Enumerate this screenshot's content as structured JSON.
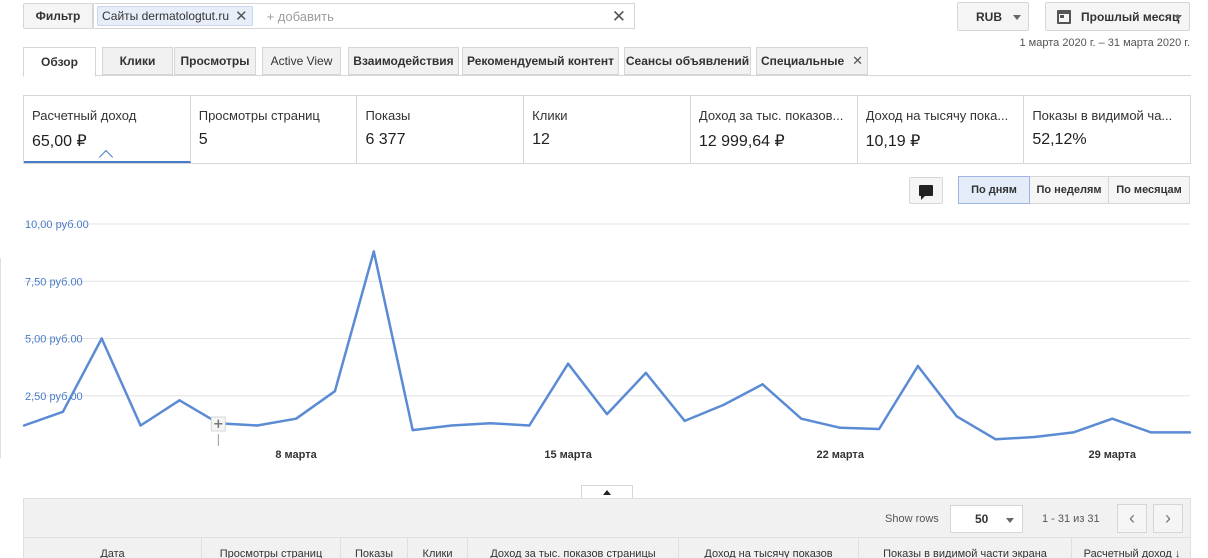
{
  "filter": {
    "label": "Фильтр",
    "chip": "Сайты dermatologtut.ru",
    "chip_close_icon": "✕",
    "add_placeholder": "+ добавить",
    "clear_icon": "✕"
  },
  "currency": {
    "label": "RUB"
  },
  "period": {
    "label": "Прошлый месяц",
    "range": "1 марта 2020 г. – 31 марта 2020 г."
  },
  "tabs": [
    {
      "label": "Обзор",
      "active": true
    },
    {
      "label": "Клики"
    },
    {
      "label": "Просмотры"
    },
    {
      "label": "Active View"
    },
    {
      "label": "Взаимодействия"
    },
    {
      "label": "Рекомендуемый контент"
    },
    {
      "label": "Сеансы объявлений"
    },
    {
      "label": "Специальные",
      "close_icon": "✕"
    }
  ],
  "metrics": [
    {
      "label": "Расчетный доход",
      "value": "65,00 ₽"
    },
    {
      "label": "Просмотры страниц",
      "value": "5"
    },
    {
      "label": "Показы",
      "value": "6 377"
    },
    {
      "label": "Клики",
      "value": "12"
    },
    {
      "label": "Доход за тыс. показов...",
      "value": "12 999,64 ₽"
    },
    {
      "label": "Доход на тысячу пока...",
      "value": "10,19 ₽"
    },
    {
      "label": "Показы в видимой ча...",
      "value": "52,12%"
    }
  ],
  "granularity": {
    "day": "По дням",
    "week": "По неделям",
    "month": "По месяцам",
    "selected": "day"
  },
  "chart_data": {
    "type": "line",
    "x_start": "2020-03-01",
    "x_end": "2020-03-31",
    "x_tick_labels": [
      "8 марта",
      "15 марта",
      "22 марта",
      "29 марта"
    ],
    "y_tick_labels": [
      "10,00 руб.00",
      "7,50 руб.00",
      "5,00 руб.00",
      "2,50 руб.00"
    ],
    "y_ticks": [
      10,
      7.5,
      5,
      2.5
    ],
    "ylim": [
      0,
      10
    ],
    "grid": true,
    "color": "#5b8bd4",
    "series": [
      {
        "values": [
          1.2,
          1.8,
          5.0,
          1.2,
          2.3,
          1.3,
          1.2,
          1.5,
          2.7,
          8.8,
          1.0,
          1.2,
          1.3,
          1.2,
          3.9,
          1.7,
          3.5,
          1.4,
          2.1,
          3.0,
          1.5,
          1.1,
          1.05,
          3.8,
          1.6,
          0.6,
          0.7,
          0.9,
          1.5,
          0.9,
          0.9
        ]
      }
    ]
  },
  "table": {
    "show_rows_label": "Show rows",
    "rows_value": "50",
    "pager_text": "1 - 31 из 31",
    "prev_icon": "‹",
    "next_icon": "›",
    "columns": [
      "Дата",
      "Просмотры страниц",
      "Показы",
      "Клики",
      "Доход за тыс. показов страницы",
      "Доход на тысячу показов",
      "Показы в видимой части экрана",
      "Расчетный доход ↓"
    ]
  }
}
